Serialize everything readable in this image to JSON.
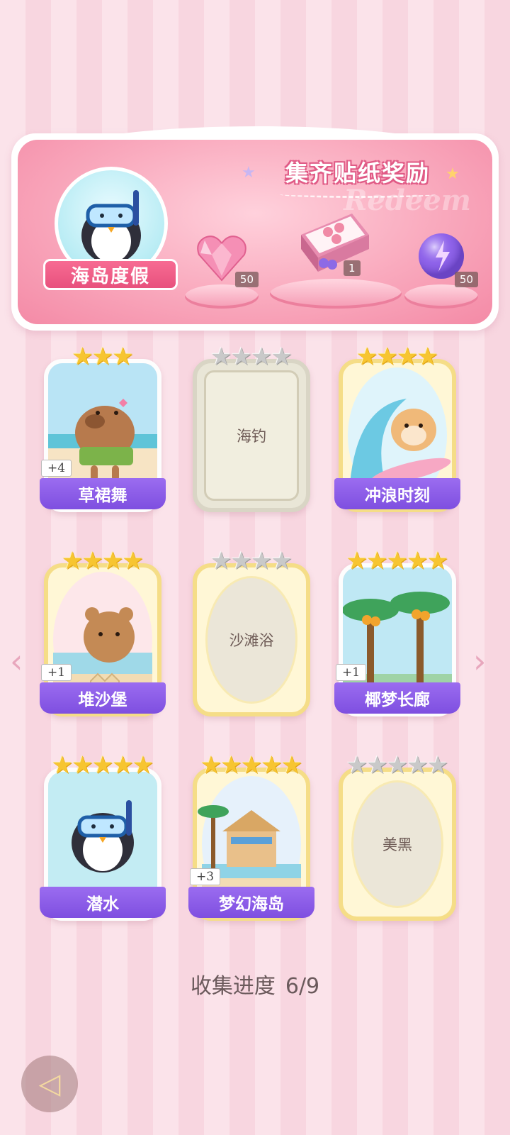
{
  "banner": {
    "title": "集齐贴纸奖励",
    "watermark": "Redeem",
    "theme_name": "海岛度假",
    "rewards": [
      {
        "item": "pink-heart-gem-icon",
        "count": "50"
      },
      {
        "item": "gift-box-icon",
        "count": "1"
      },
      {
        "item": "purple-energy-orb-icon",
        "count": "50"
      }
    ]
  },
  "cards": [
    {
      "name": "草裙舞",
      "stars_filled": 3,
      "stars_total": 3,
      "collected": true,
      "dup": "+4",
      "art": "capybara-hula-dancer"
    },
    {
      "name": "海钓",
      "stars_filled": 0,
      "stars_total": 4,
      "collected": false,
      "dup": "",
      "art": "locked"
    },
    {
      "name": "冲浪时刻",
      "stars_filled": 4,
      "stars_total": 4,
      "collected": true,
      "dup": "",
      "art": "hamster-surfing"
    },
    {
      "name": "堆沙堡",
      "stars_filled": 4,
      "stars_total": 4,
      "collected": true,
      "dup": "+1",
      "art": "bear-sandcastle"
    },
    {
      "name": "沙滩浴",
      "stars_filled": 0,
      "stars_total": 4,
      "collected": false,
      "dup": "",
      "art": "locked"
    },
    {
      "name": "椰梦长廊",
      "stars_filled": 5,
      "stars_total": 5,
      "collected": true,
      "dup": "+1",
      "art": "coconut-palms"
    },
    {
      "name": "潜水",
      "stars_filled": 5,
      "stars_total": 5,
      "collected": true,
      "dup": "",
      "art": "penguin-diving"
    },
    {
      "name": "梦幻海岛",
      "stars_filled": 5,
      "stars_total": 5,
      "collected": true,
      "dup": "+3",
      "art": "beach-hut"
    },
    {
      "name": "美黑",
      "stars_filled": 0,
      "stars_total": 5,
      "collected": false,
      "dup": "",
      "art": "locked"
    }
  ],
  "progress": {
    "label": "收集进度",
    "value": "6/9"
  },
  "colors": {
    "label_purple": "#8a5ce8",
    "gold_frame": "#f5dd87",
    "pink_banner": "#f59ab3"
  }
}
